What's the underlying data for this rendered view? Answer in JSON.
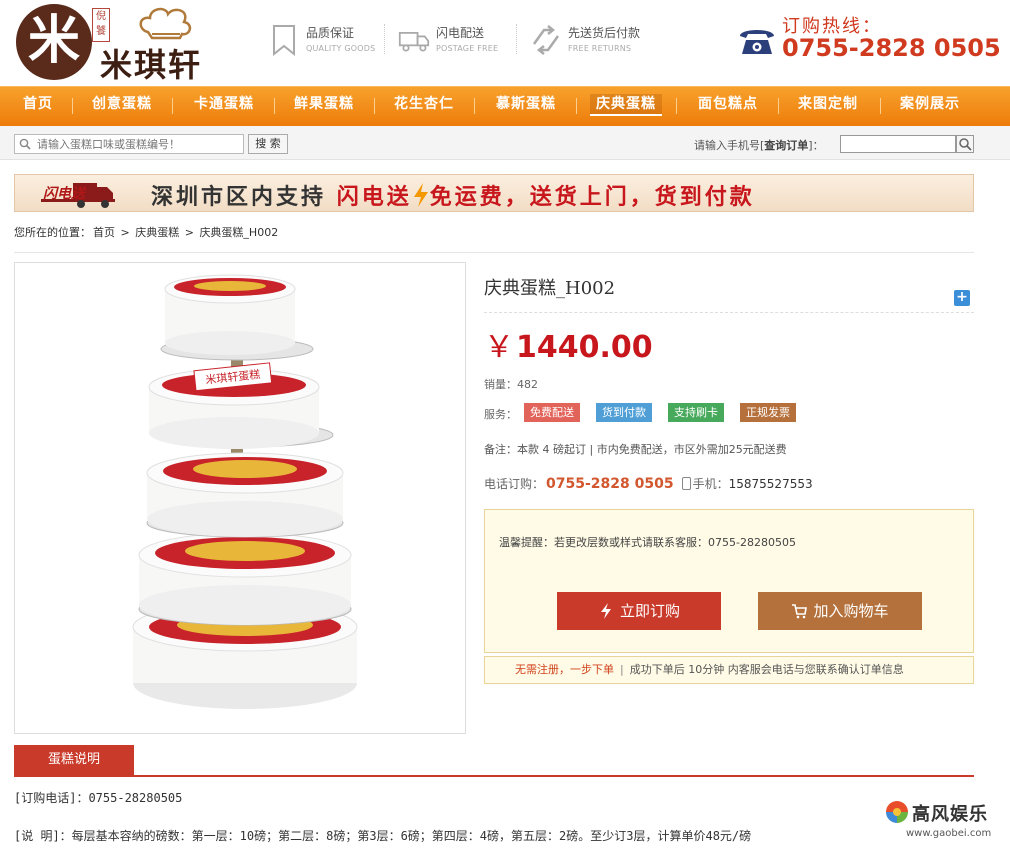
{
  "header": {
    "logo_mark": "米",
    "logo_stamp": "倪饕",
    "logo_text": "米琪轩",
    "features": [
      {
        "title": "品质保证",
        "subtitle": "QUALITY GOODS",
        "icon": "bookmark-icon"
      },
      {
        "title": "闪电配送",
        "subtitle": "POSTAGE FREE",
        "icon": "truck-icon"
      },
      {
        "title": "先送货后付款",
        "subtitle": "FREE RETURNS",
        "icon": "refresh-icon"
      }
    ],
    "hotline_label": "订购热线：",
    "hotline_number": "0755-2828 0505"
  },
  "nav": {
    "items": [
      {
        "label": "首页"
      },
      {
        "label": "创意蛋糕"
      },
      {
        "label": "卡通蛋糕"
      },
      {
        "label": "鲜果蛋糕"
      },
      {
        "label": "花生杏仁"
      },
      {
        "label": "慕斯蛋糕"
      },
      {
        "label": "庆典蛋糕"
      },
      {
        "label": "面包糕点"
      },
      {
        "label": "来图定制"
      },
      {
        "label": "案例展示"
      }
    ],
    "active": "庆典蛋糕"
  },
  "search": {
    "placeholder": "请输入蛋糕口味或蛋糕编号！",
    "button": "搜 索",
    "order_prefix": "请输入手机号[",
    "order_bold": "查询订单",
    "order_suffix": "]："
  },
  "banner": {
    "truck_text": "闪电送",
    "text_black": "深圳市区内支持",
    "text_red": "闪电送",
    "text_rest": "免运费，送货上门，货到付款"
  },
  "breadcrumb": {
    "prefix": "您所在的位置：",
    "items": [
      "首页",
      "庆典蛋糕",
      "庆典蛋糕_H002"
    ],
    "separator": ">"
  },
  "product": {
    "title": "庆典蛋糕_H002",
    "plus": "+",
    "currency": "￥",
    "price": "1440.00",
    "sales_label": "销量：",
    "sales": "482",
    "service_label": "服务：",
    "services": [
      {
        "label": "免费配送",
        "color": "#e2635a"
      },
      {
        "label": "货到付款",
        "color": "#4f9ed6"
      },
      {
        "label": "支持刷卡",
        "color": "#46a95b"
      },
      {
        "label": "正规发票",
        "color": "#b5703c"
      }
    ],
    "note": "备注：本款 4 磅起订 | 市内免费配送，市区外需加25元配送费",
    "phone_label": "电话订购：",
    "phone": "0755-2828 0505",
    "mobile_label": "手机：",
    "mobile": "15875527553",
    "tip": "温馨提醒：若更改层数或样式请联系客服：0755-28280505",
    "buy_label": "立即订购",
    "cart_label": "加入购物车",
    "notebar_red": "无需注册，一步下单",
    "notebar_sep": "|",
    "notebar_text": "成功下单后 10分钟 内客服会电话与您联系确认订单信息",
    "image_label": "米琪轩蛋糕"
  },
  "details": {
    "tab": "蛋糕说明",
    "line1": "[订购电话]：0755-28280505",
    "line2": "[说 明]：每层基本容纳的磅数：第一层：10磅；第二层：8磅；第3层：6磅；第四层：4磅，第五层：2磅。至少订3层，计算单价48元/磅"
  },
  "watermark": {
    "text": "高风娱乐",
    "url": "www.gaobei.com"
  },
  "colors": {
    "nav_orange": "#ee7c0a",
    "price_red": "#c8161d",
    "order_btn": "#c93a2a",
    "cart_btn": "#b4713b"
  }
}
